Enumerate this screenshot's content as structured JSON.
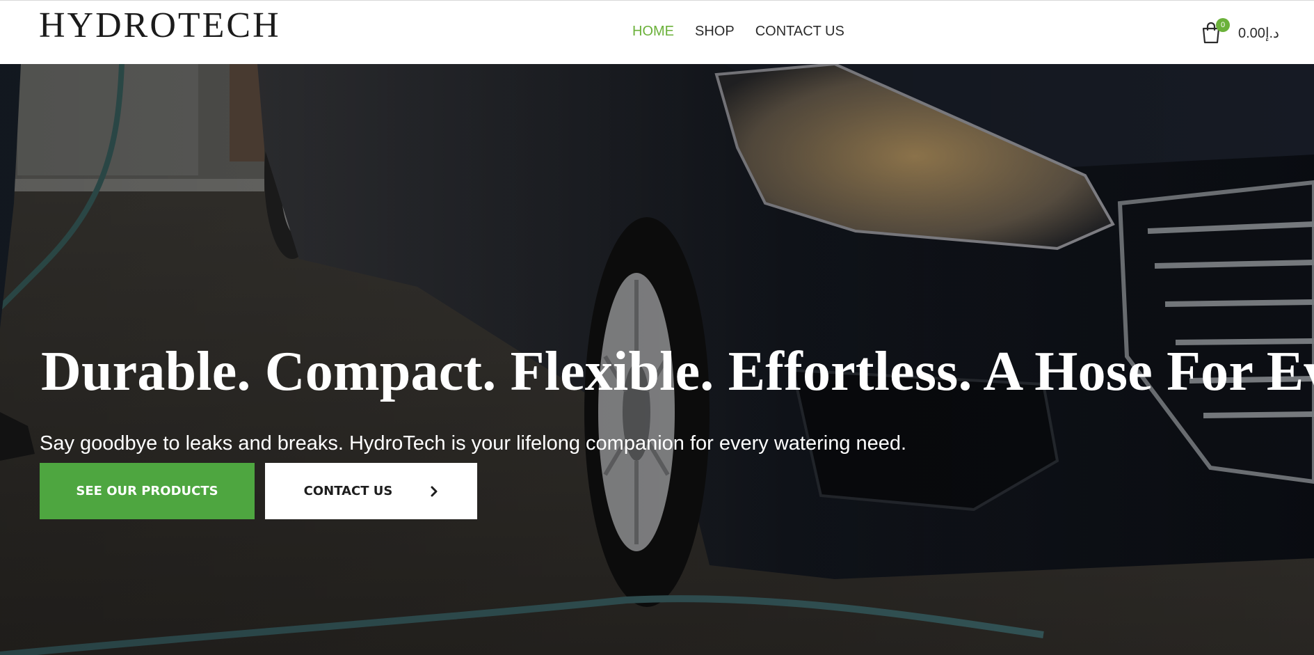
{
  "header": {
    "logo": "HYDROTECH",
    "nav": [
      {
        "label": "HOME",
        "active": true
      },
      {
        "label": "SHOP",
        "active": false
      },
      {
        "label": "CONTACT US",
        "active": false
      }
    ],
    "cart": {
      "icon": "shopping-bag-icon",
      "count": "0",
      "total": "0.00د.إ"
    }
  },
  "hero": {
    "title": "Durable. Compact. Flexible. Effortless. A Hose For Everything",
    "subtitle": "Say goodbye to leaks and breaks. HydroTech is your lifelong companion for every watering need.",
    "primary_button": "SEE OUR PRODUCTS",
    "secondary_button": "CONTACT US",
    "secondary_button_icon": "chevron-right-icon"
  },
  "colors": {
    "accent_green": "#6bb13a",
    "button_green": "#4ea640",
    "text_dark": "#2b2b2b"
  }
}
